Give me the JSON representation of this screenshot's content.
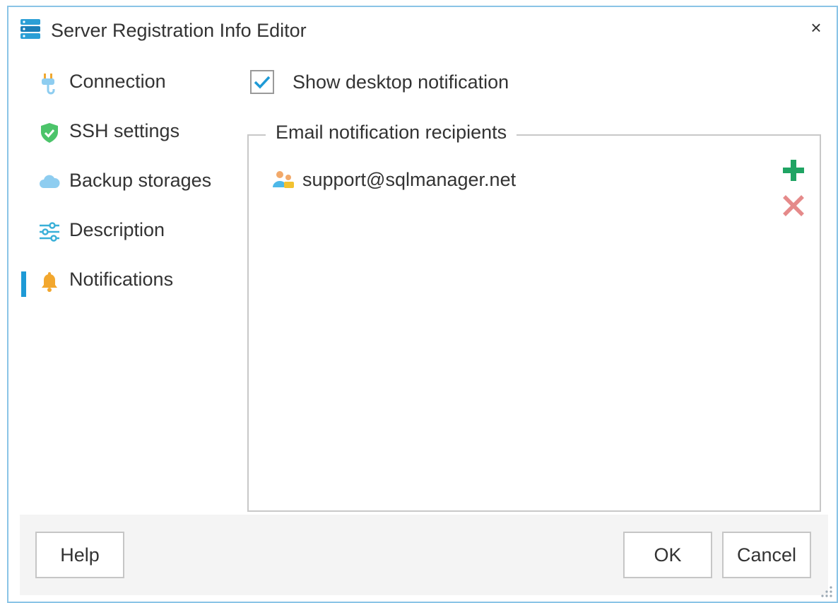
{
  "window": {
    "title": "Server Registration Info Editor",
    "close_label": "×",
    "icon": "server-stack-icon"
  },
  "sidebar": {
    "items": [
      {
        "label": "Connection",
        "icon": "plug-icon",
        "active": false
      },
      {
        "label": "SSH settings",
        "icon": "shield-check-icon",
        "active": false
      },
      {
        "label": "Backup storages",
        "icon": "cloud-icon",
        "active": false
      },
      {
        "label": "Description",
        "icon": "sliders-icon",
        "active": false
      },
      {
        "label": "Notifications",
        "icon": "bell-icon",
        "active": true
      }
    ]
  },
  "notifications": {
    "desktop_checkbox_label": "Show desktop notification",
    "desktop_checked": true,
    "email_group_label": "Email notification recipients",
    "recipients": [
      {
        "email": "support@sqlmanager.net",
        "icon": "user-group-icon"
      }
    ],
    "add_icon": "plus-icon",
    "remove_icon": "x-icon"
  },
  "footer": {
    "help_label": "Help",
    "ok_label": "OK",
    "cancel_label": "Cancel"
  },
  "colors": {
    "accent": "#1e9ad6",
    "window_border": "#8ac4e6",
    "add_green": "#1fa463",
    "remove_red": "#e58a8a",
    "footer_bg": "#f4f4f4"
  }
}
